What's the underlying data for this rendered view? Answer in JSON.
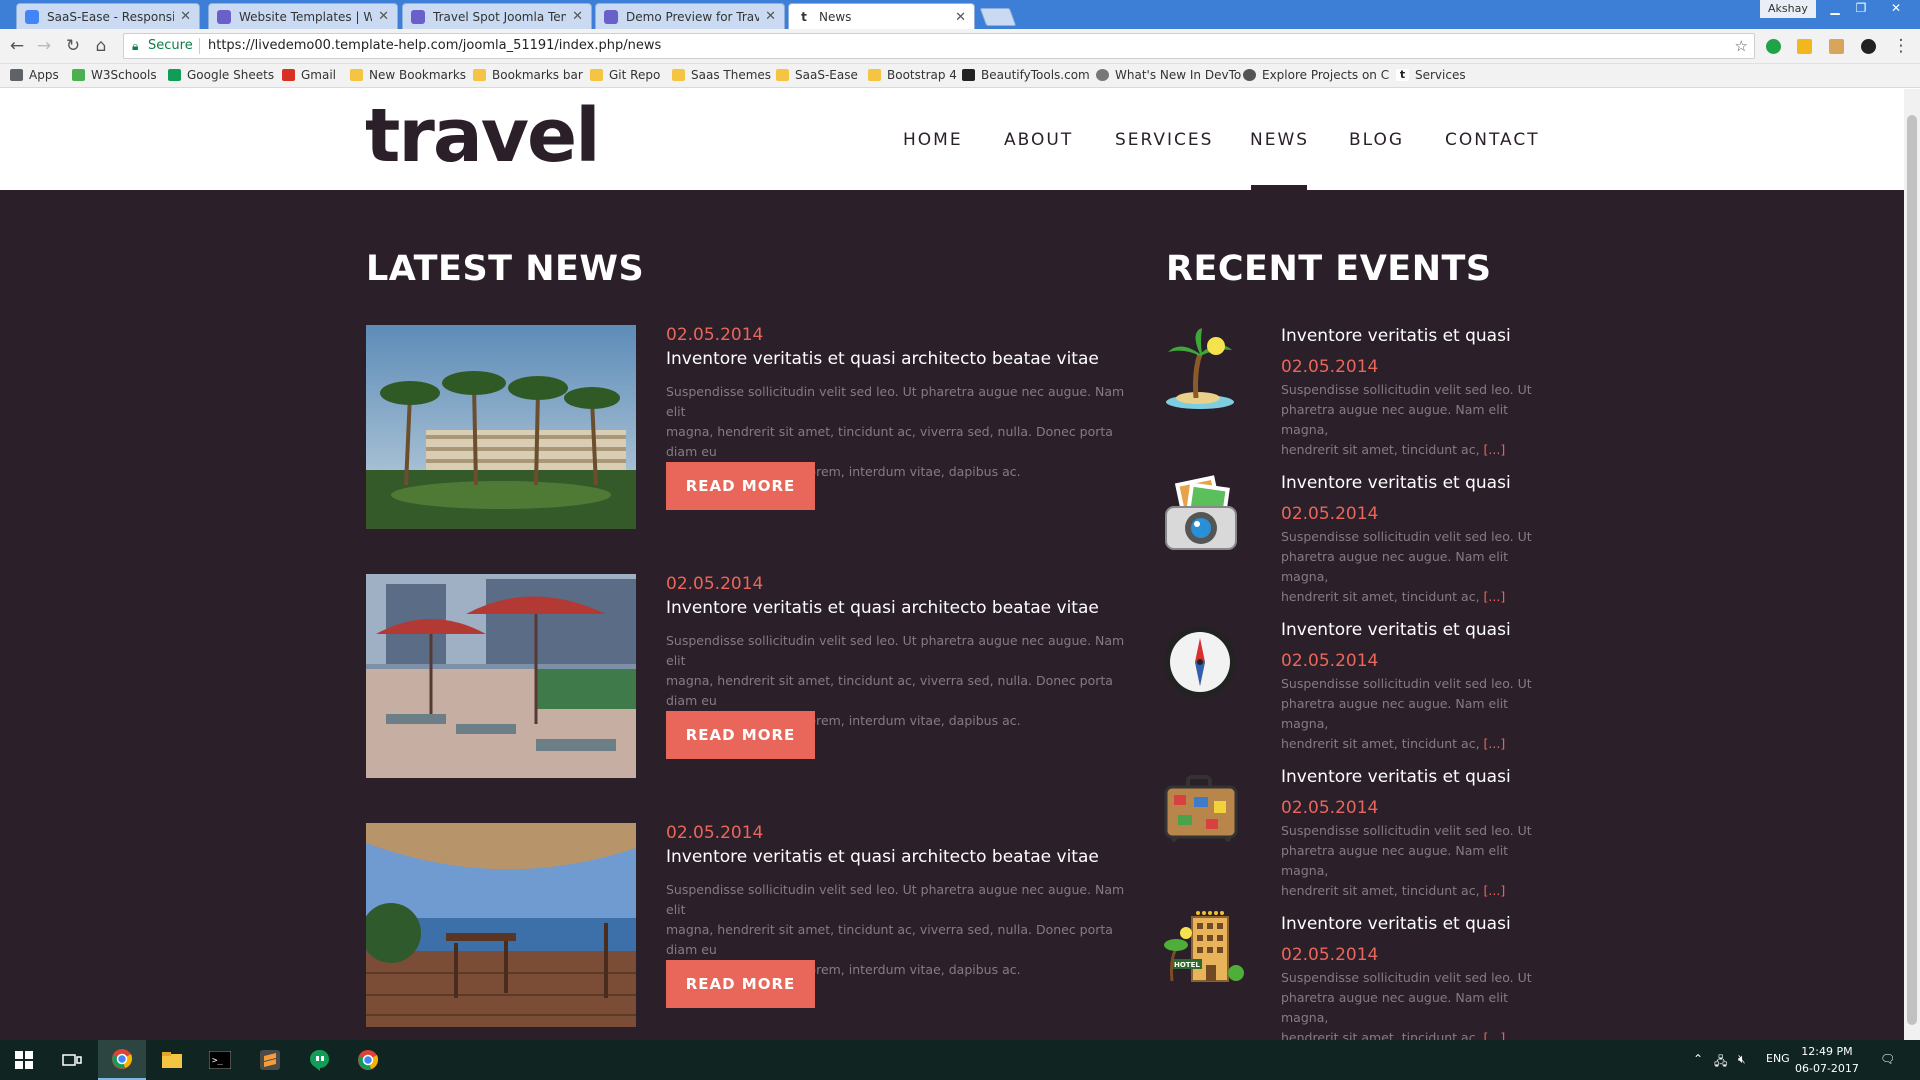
{
  "browser": {
    "tabs": [
      {
        "title": "SaaS-Ease - Responsive S",
        "favicon": "google-drive-icon"
      },
      {
        "title": "Website Templates | Web",
        "favicon": "template-monster-icon"
      },
      {
        "title": "Travel Spot Joomla Temp",
        "favicon": "template-monster-icon"
      },
      {
        "title": "Demo Preview for Travel",
        "favicon": "template-monster-icon"
      },
      {
        "title": "News",
        "favicon": "t-icon"
      }
    ],
    "user": "Akshay",
    "secure_label": "Secure",
    "url": "https://livedemo00.template-help.com/joomla_51191/index.php/news",
    "bookmarks": [
      "Apps",
      "W3Schools",
      "Google Sheets",
      "Gmail",
      "New Bookmarks",
      "Bookmarks bar",
      "Git Repo",
      "Saas Themes",
      "SaaS-Ease",
      "Bootstrap 4",
      "BeautifyTools.com",
      "What's New In DevTo",
      "Explore Projects on C",
      "Services"
    ]
  },
  "site": {
    "logo": "travel",
    "nav": [
      "HOME",
      "ABOUT",
      "SERVICES",
      "NEWS",
      "BLOG",
      "CONTACT"
    ],
    "active_nav": "NEWS"
  },
  "latest_news": {
    "heading": "LATEST NEWS",
    "read_more_label": "READ MORE",
    "items": [
      {
        "date": "02.05.2014",
        "title": "Inventore veritatis et quasi architecto beatae vitae",
        "text_lines": [
          "Suspendisse sollicitudin velit sed leo. Ut pharetra augue nec augue. Nam elit",
          "magna, hendrerit sit amet, tincidunt ac, viverra sed, nulla. Donec porta diam eu",
          "massa. Quisque diam lorem, interdum vitae, dapibus ac."
        ]
      },
      {
        "date": "02.05.2014",
        "title": "Inventore veritatis et quasi architecto beatae vitae",
        "text_lines": [
          "Suspendisse sollicitudin velit sed leo. Ut pharetra augue nec augue. Nam elit",
          "magna, hendrerit sit amet, tincidunt ac, viverra sed, nulla. Donec porta diam eu",
          "massa. Quisque diam lorem, interdum vitae, dapibus ac."
        ]
      },
      {
        "date": "02.05.2014",
        "title": "Inventore veritatis et quasi architecto beatae vitae",
        "text_lines": [
          "Suspendisse sollicitudin velit sed leo. Ut pharetra augue nec augue. Nam elit",
          "magna, hendrerit sit amet, tincidunt ac, viverra sed, nulla. Donec porta diam eu",
          "massa. Quisque diam lorem, interdum vitae, dapibus ac."
        ]
      }
    ]
  },
  "recent_events": {
    "heading": "RECENT EVENTS",
    "more_label": "[...]",
    "items": [
      {
        "icon": "palm-island-icon",
        "title": "Inventore veritatis et quasi",
        "date": "02.05.2014",
        "text_lines": [
          "Suspendisse sollicitudin velit sed leo. Ut",
          "pharetra augue nec augue. Nam elit magna,",
          "hendrerit sit amet, tincidunt ac,"
        ]
      },
      {
        "icon": "camera-photos-icon",
        "title": "Inventore veritatis et quasi",
        "date": "02.05.2014",
        "text_lines": [
          "Suspendisse sollicitudin velit sed leo. Ut",
          "pharetra augue nec augue. Nam elit magna,",
          "hendrerit sit amet, tincidunt ac,"
        ]
      },
      {
        "icon": "compass-icon",
        "title": "Inventore veritatis et quasi",
        "date": "02.05.2014",
        "text_lines": [
          "Suspendisse sollicitudin velit sed leo. Ut",
          "pharetra augue nec augue. Nam elit magna,",
          "hendrerit sit amet, tincidunt ac,"
        ]
      },
      {
        "icon": "suitcase-icon",
        "title": "Inventore veritatis et quasi",
        "date": "02.05.2014",
        "text_lines": [
          "Suspendisse sollicitudin velit sed leo. Ut",
          "pharetra augue nec augue. Nam elit magna,",
          "hendrerit sit amet, tincidunt ac,"
        ]
      },
      {
        "icon": "hotel-icon",
        "title": "Inventore veritatis et quasi",
        "date": "02.05.2014",
        "text_lines": [
          "Suspendisse sollicitudin velit sed leo. Ut",
          "pharetra augue nec augue. Nam elit magna,",
          "hendrerit sit amet, tincidunt ac,"
        ]
      }
    ]
  },
  "taskbar": {
    "language": "ENG",
    "time": "12:49 PM",
    "date": "06-07-2017"
  },
  "colors": {
    "page_bg": "#2b1f2a",
    "accent": "#e8675a",
    "muted_text": "#867b85",
    "header_bg": "#ffffff"
  }
}
